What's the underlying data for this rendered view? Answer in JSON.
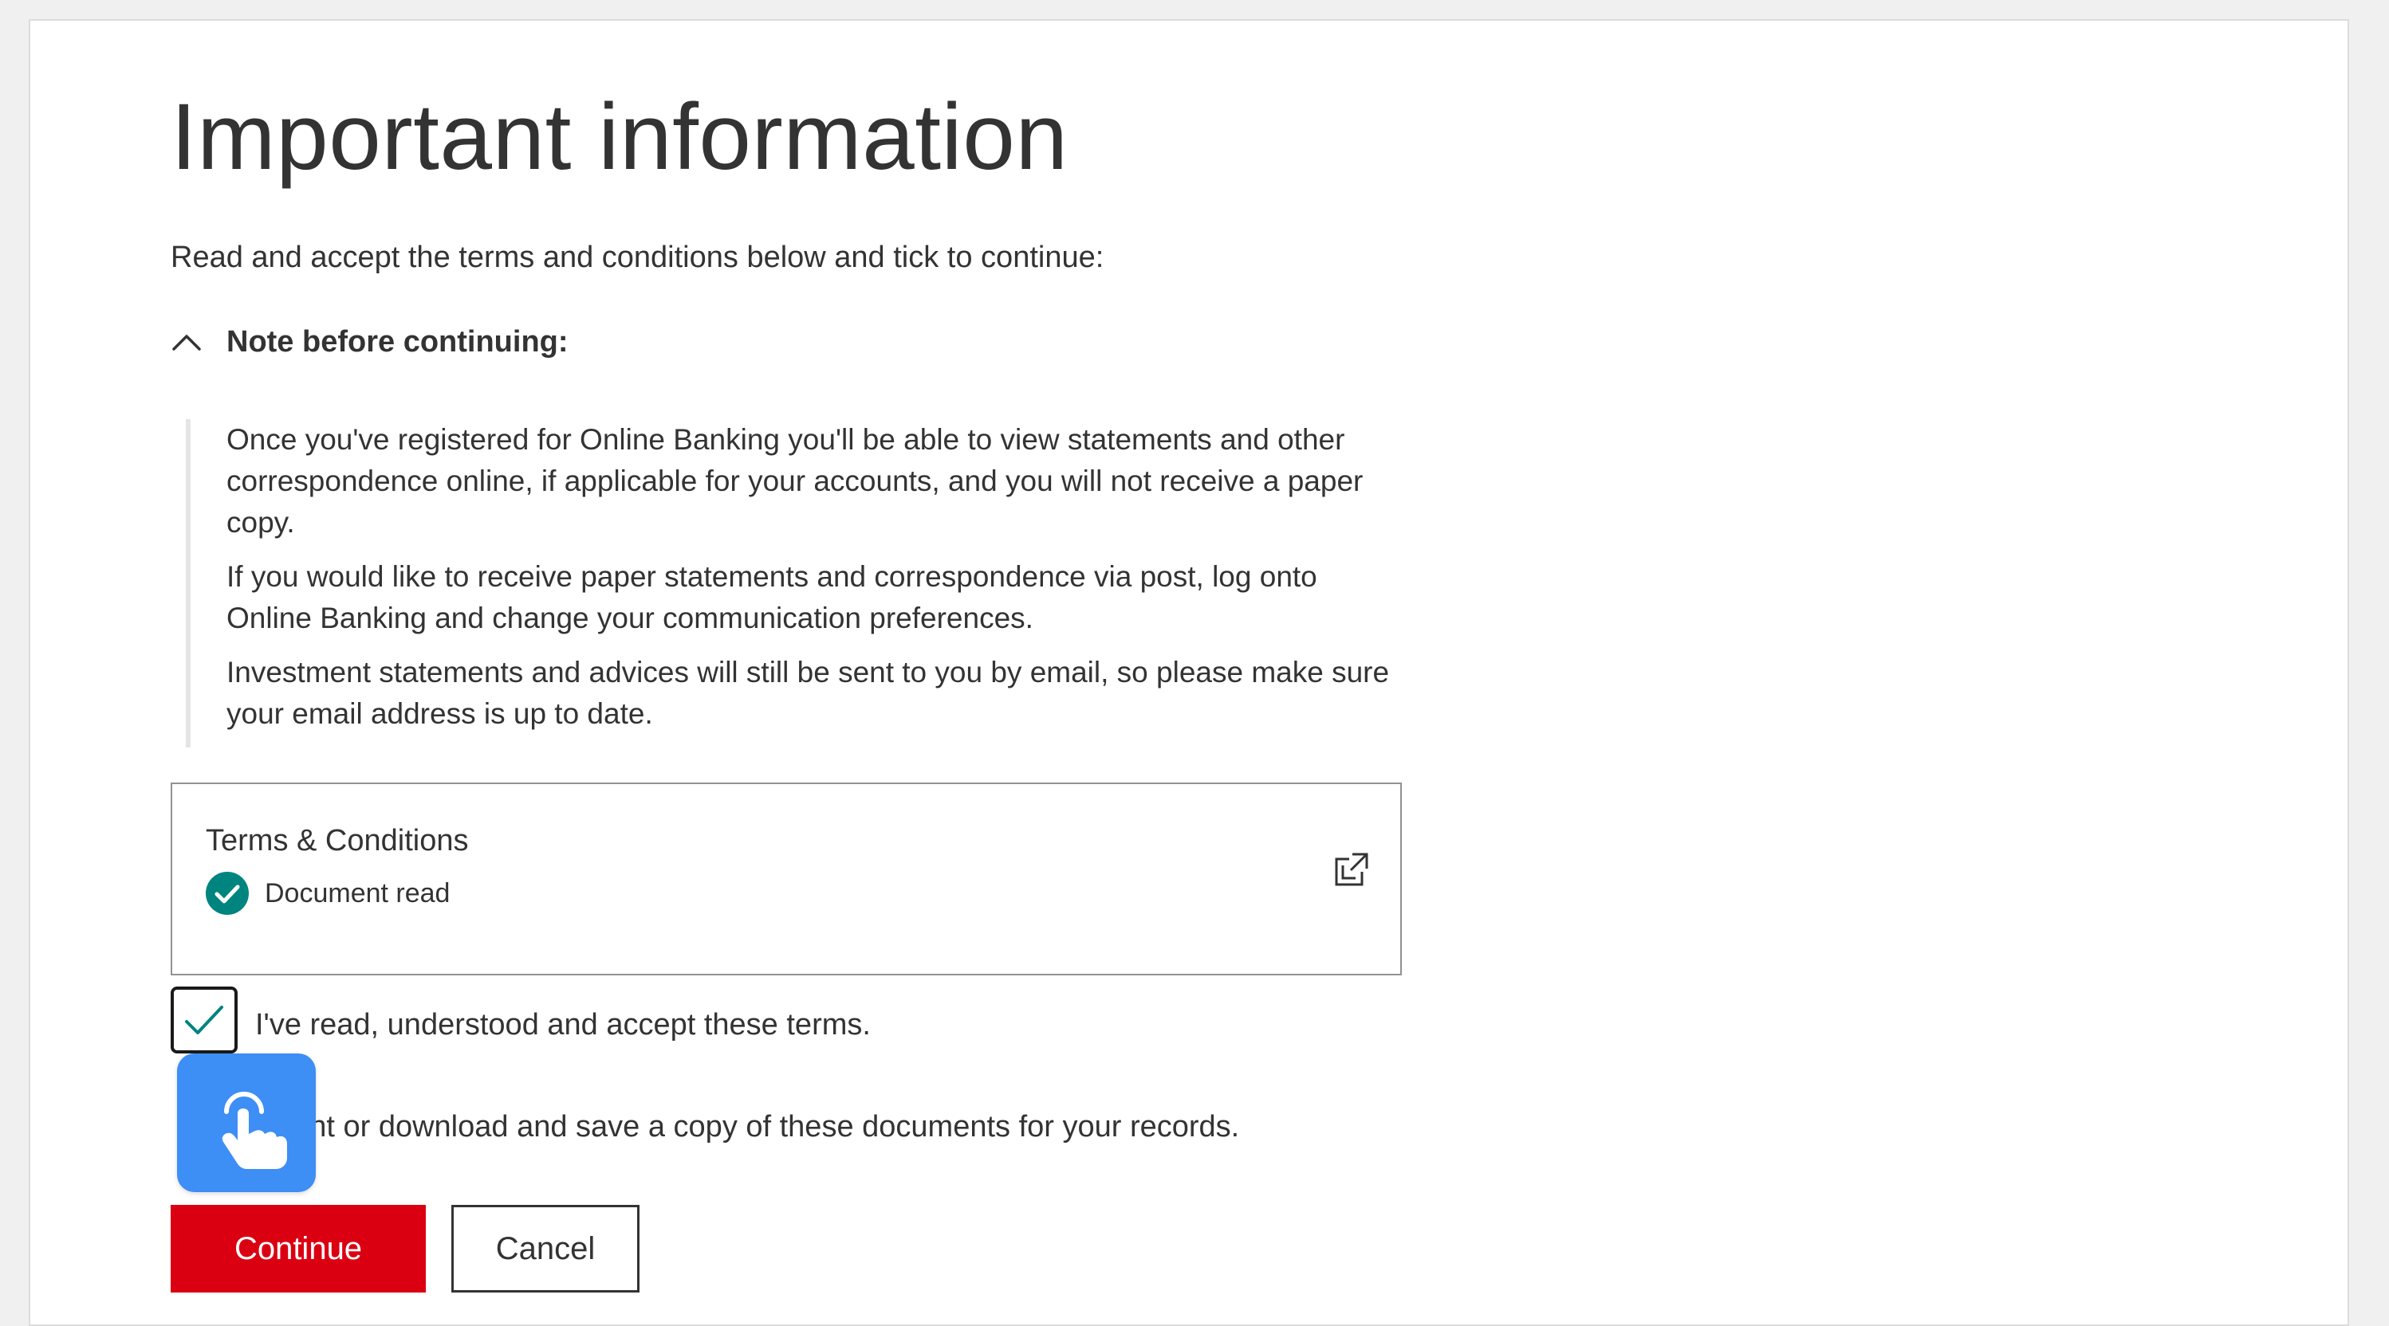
{
  "page": {
    "title": "Important information",
    "intro": "Read and accept the terms and conditions below and tick to continue:"
  },
  "note": {
    "title": "Note before continuing:",
    "expanded": true,
    "toggle_icon": "chevron-up-icon",
    "paragraphs": [
      "Once you've registered for Online Banking you'll be able to view statements and other correspondence online, if applicable for your accounts, and you will not receive a paper copy.",
      "If you would like to receive paper statements and correspondence via post, log onto Online Banking and change your communication preferences.",
      "Investment statements and advices will still be sent to you by email, so please make sure your email address is up to date."
    ]
  },
  "terms": {
    "title": "Terms & Conditions",
    "status": "Document read",
    "status_icon": "check-circle-icon",
    "status_color": "#00847f",
    "link_icon": "external-link-icon"
  },
  "accept": {
    "checked": true,
    "label": "I've read, understood and accept these terms.",
    "check_color": "#00847f"
  },
  "print_note": "print or download and save a copy of these documents for your records.",
  "overlay": {
    "icon": "tap-hand-icon",
    "color": "#3d8ef5"
  },
  "actions": {
    "continue_label": "Continue",
    "continue_color": "#db0011",
    "cancel_label": "Cancel"
  }
}
